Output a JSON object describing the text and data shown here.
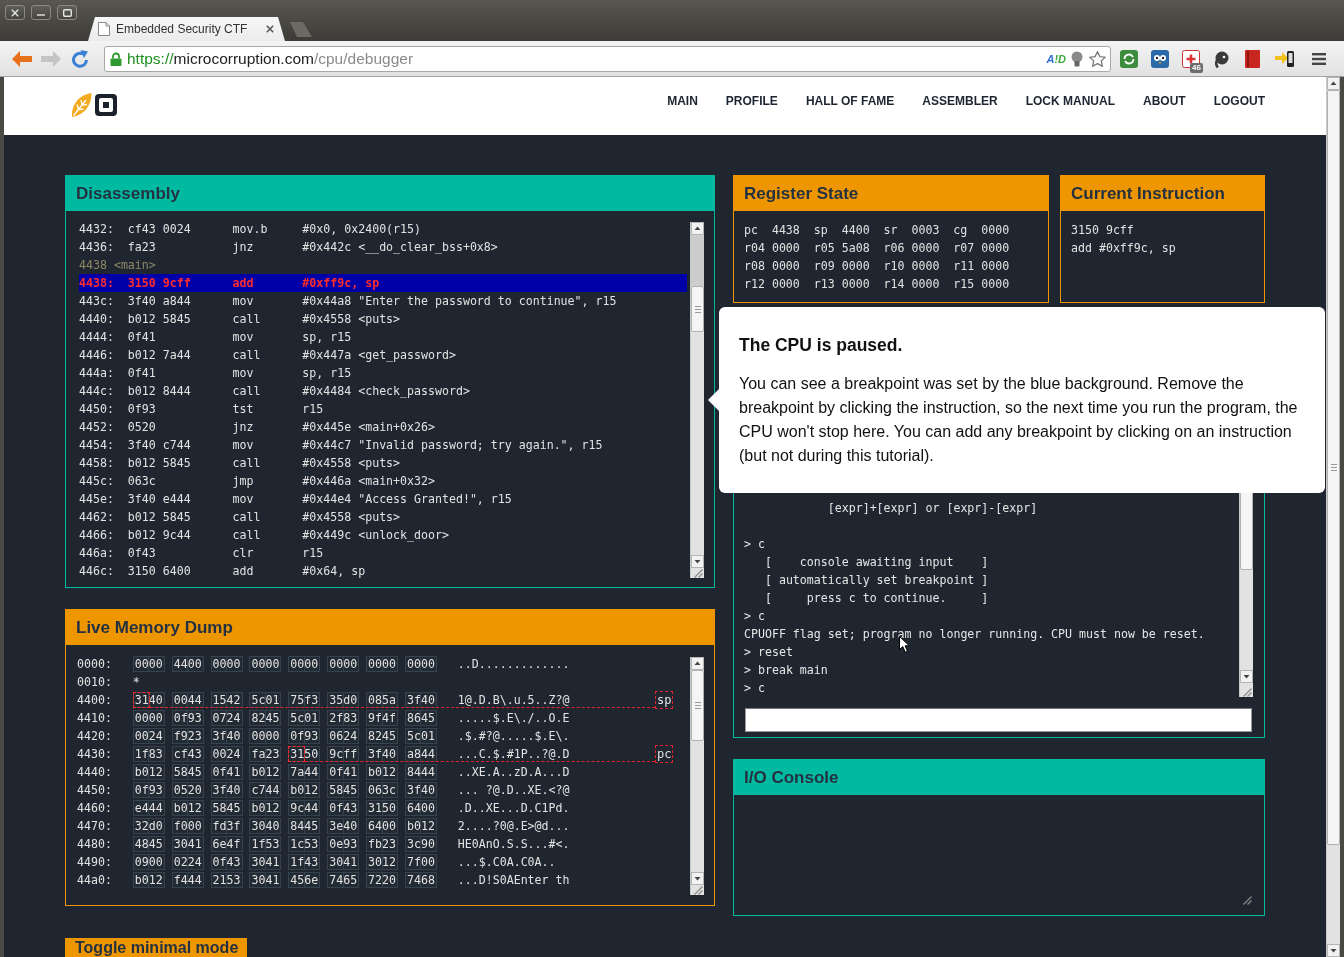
{
  "tab": {
    "title": "Embedded Security CTF"
  },
  "address_bar": {
    "scheme": "https://",
    "host": "microcorruption.com",
    "path": "/cpu/debugger",
    "extension_label": "A!D"
  },
  "toolbar": {
    "badge": "46"
  },
  "nav": [
    "MAIN",
    "PROFILE",
    "HALL OF FAME",
    "ASSEMBLER",
    "LOCK MANUAL",
    "ABOUT",
    "LOGOUT"
  ],
  "disassembly": {
    "title": "Disassembly",
    "rows": [
      {
        "kind": "instruction",
        "address": "4432:",
        "bytes": "cf43 0024",
        "mnemonic": "mov.b",
        "operands": "#0x0, 0x2400(r15)",
        "breakpoint": false,
        "current": false
      },
      {
        "kind": "instruction",
        "address": "4436:",
        "bytes": "fa23",
        "mnemonic": "jnz",
        "operands": "#0x442c <__do_clear_bss+0x8>",
        "breakpoint": false,
        "current": false
      },
      {
        "kind": "label",
        "text": "4438 <main>",
        "breakpoint": false,
        "current": false
      },
      {
        "kind": "instruction",
        "address": "4438:",
        "bytes": "3150 9cff",
        "mnemonic": "add",
        "operands": "#0xff9c, sp",
        "breakpoint": true,
        "current": true
      },
      {
        "kind": "instruction",
        "address": "443c:",
        "bytes": "3f40 a844",
        "mnemonic": "mov",
        "operands": "#0x44a8 \"Enter the password to continue\", r15",
        "breakpoint": false,
        "current": false
      },
      {
        "kind": "instruction",
        "address": "4440:",
        "bytes": "b012 5845",
        "mnemonic": "call",
        "operands": "#0x4558 <puts>",
        "breakpoint": false,
        "current": false
      },
      {
        "kind": "instruction",
        "address": "4444:",
        "bytes": "0f41",
        "mnemonic": "mov",
        "operands": "sp, r15",
        "breakpoint": false,
        "current": false
      },
      {
        "kind": "instruction",
        "address": "4446:",
        "bytes": "b012 7a44",
        "mnemonic": "call",
        "operands": "#0x447a <get_password>",
        "breakpoint": false,
        "current": false
      },
      {
        "kind": "instruction",
        "address": "444a:",
        "bytes": "0f41",
        "mnemonic": "mov",
        "operands": "sp, r15",
        "breakpoint": false,
        "current": false
      },
      {
        "kind": "instruction",
        "address": "444c:",
        "bytes": "b012 8444",
        "mnemonic": "call",
        "operands": "#0x4484 <check_password>",
        "breakpoint": false,
        "current": false
      },
      {
        "kind": "instruction",
        "address": "4450:",
        "bytes": "0f93",
        "mnemonic": "tst",
        "operands": "r15",
        "breakpoint": false,
        "current": false
      },
      {
        "kind": "instruction",
        "address": "4452:",
        "bytes": "0520",
        "mnemonic": "jnz",
        "operands": "#0x445e <main+0x26>",
        "breakpoint": false,
        "current": false
      },
      {
        "kind": "instruction",
        "address": "4454:",
        "bytes": "3f40 c744",
        "mnemonic": "mov",
        "operands": "#0x44c7 \"Invalid password; try again.\", r15",
        "breakpoint": false,
        "current": false
      },
      {
        "kind": "instruction",
        "address": "4458:",
        "bytes": "b012 5845",
        "mnemonic": "call",
        "operands": "#0x4558 <puts>",
        "breakpoint": false,
        "current": false
      },
      {
        "kind": "instruction",
        "address": "445c:",
        "bytes": "063c",
        "mnemonic": "jmp",
        "operands": "#0x446a <main+0x32>",
        "breakpoint": false,
        "current": false
      },
      {
        "kind": "instruction",
        "address": "445e:",
        "bytes": "3f40 e444",
        "mnemonic": "mov",
        "operands": "#0x44e4 \"Access Granted!\", r15",
        "breakpoint": false,
        "current": false
      },
      {
        "kind": "instruction",
        "address": "4462:",
        "bytes": "b012 5845",
        "mnemonic": "call",
        "operands": "#0x4558 <puts>",
        "breakpoint": false,
        "current": false
      },
      {
        "kind": "instruction",
        "address": "4466:",
        "bytes": "b012 9c44",
        "mnemonic": "call",
        "operands": "#0x449c <unlock_door>",
        "breakpoint": false,
        "current": false
      },
      {
        "kind": "instruction",
        "address": "446a:",
        "bytes": "0f43",
        "mnemonic": "clr",
        "operands": "r15",
        "breakpoint": false,
        "current": false
      },
      {
        "kind": "instruction",
        "address": "446c:",
        "bytes": "3150 6400",
        "mnemonic": "add",
        "operands": "#0x64, sp",
        "breakpoint": false,
        "current": false
      }
    ]
  },
  "memory_dump": {
    "title": "Live Memory Dump",
    "rows": [
      {
        "kind": "data",
        "address": "0000:",
        "words": [
          {
            "hex": "0000",
            "pointer_target": false
          },
          {
            "hex": "4400",
            "pointer_target": false
          },
          {
            "hex": "0000",
            "pointer_target": false
          },
          {
            "hex": "0000",
            "pointer_target": false
          },
          {
            "hex": "0000",
            "pointer_target": false
          },
          {
            "hex": "0000",
            "pointer_target": false
          },
          {
            "hex": "0000",
            "pointer_target": false
          },
          {
            "hex": "0000",
            "pointer_target": false
          }
        ],
        "ascii": "..D............."
      },
      {
        "kind": "repeat",
        "address": "0010:",
        "text": "*"
      },
      {
        "kind": "data",
        "address": "4400:",
        "words": [
          {
            "hex": "3140",
            "pointer_target": true
          },
          {
            "hex": "0044",
            "pointer_target": false
          },
          {
            "hex": "1542",
            "pointer_target": false
          },
          {
            "hex": "5c01",
            "pointer_target": false
          },
          {
            "hex": "75f3",
            "pointer_target": false
          },
          {
            "hex": "35d0",
            "pointer_target": false
          },
          {
            "hex": "085a",
            "pointer_target": false
          },
          {
            "hex": "3f40",
            "pointer_target": false
          }
        ],
        "ascii": "1@.D.B\\.u.5..Z?@",
        "pointer_label": "sp"
      },
      {
        "kind": "data",
        "address": "4410:",
        "words": [
          {
            "hex": "0000",
            "pointer_target": false
          },
          {
            "hex": "0f93",
            "pointer_target": false
          },
          {
            "hex": "0724",
            "pointer_target": false
          },
          {
            "hex": "8245",
            "pointer_target": false
          },
          {
            "hex": "5c01",
            "pointer_target": false
          },
          {
            "hex": "2f83",
            "pointer_target": false
          },
          {
            "hex": "9f4f",
            "pointer_target": false
          },
          {
            "hex": "8645",
            "pointer_target": false
          }
        ],
        "ascii": ".....$.E\\./..O.E"
      },
      {
        "kind": "data",
        "address": "4420:",
        "words": [
          {
            "hex": "0024",
            "pointer_target": false
          },
          {
            "hex": "f923",
            "pointer_target": false
          },
          {
            "hex": "3f40",
            "pointer_target": false
          },
          {
            "hex": "0000",
            "pointer_target": false
          },
          {
            "hex": "0f93",
            "pointer_target": false
          },
          {
            "hex": "0624",
            "pointer_target": false
          },
          {
            "hex": "8245",
            "pointer_target": false
          },
          {
            "hex": "5c01",
            "pointer_target": false
          }
        ],
        "ascii": ".$.#?@.....$.E\\."
      },
      {
        "kind": "data",
        "address": "4430:",
        "words": [
          {
            "hex": "1f83",
            "pointer_target": false
          },
          {
            "hex": "cf43",
            "pointer_target": false
          },
          {
            "hex": "0024",
            "pointer_target": false
          },
          {
            "hex": "fa23",
            "pointer_target": false
          },
          {
            "hex": "3150",
            "pointer_target": true
          },
          {
            "hex": "9cff",
            "pointer_target": false
          },
          {
            "hex": "3f40",
            "pointer_target": false
          },
          {
            "hex": "a844",
            "pointer_target": false
          }
        ],
        "ascii": "...C.$.#1P..?@.D",
        "pointer_label": "pc"
      },
      {
        "kind": "data",
        "address": "4440:",
        "words": [
          {
            "hex": "b012",
            "pointer_target": false
          },
          {
            "hex": "5845",
            "pointer_target": false
          },
          {
            "hex": "0f41",
            "pointer_target": false
          },
          {
            "hex": "b012",
            "pointer_target": false
          },
          {
            "hex": "7a44",
            "pointer_target": false
          },
          {
            "hex": "0f41",
            "pointer_target": false
          },
          {
            "hex": "b012",
            "pointer_target": false
          },
          {
            "hex": "8444",
            "pointer_target": false
          }
        ],
        "ascii": "..XE.A..zD.A...D"
      },
      {
        "kind": "data",
        "address": "4450:",
        "words": [
          {
            "hex": "0f93",
            "pointer_target": false
          },
          {
            "hex": "0520",
            "pointer_target": false
          },
          {
            "hex": "3f40",
            "pointer_target": false
          },
          {
            "hex": "c744",
            "pointer_target": false
          },
          {
            "hex": "b012",
            "pointer_target": false
          },
          {
            "hex": "5845",
            "pointer_target": false
          },
          {
            "hex": "063c",
            "pointer_target": false
          },
          {
            "hex": "3f40",
            "pointer_target": false
          }
        ],
        "ascii": "... ?@.D..XE.<?@"
      },
      {
        "kind": "data",
        "address": "4460:",
        "words": [
          {
            "hex": "e444",
            "pointer_target": false
          },
          {
            "hex": "b012",
            "pointer_target": false
          },
          {
            "hex": "5845",
            "pointer_target": false
          },
          {
            "hex": "b012",
            "pointer_target": false
          },
          {
            "hex": "9c44",
            "pointer_target": false
          },
          {
            "hex": "0f43",
            "pointer_target": false
          },
          {
            "hex": "3150",
            "pointer_target": false
          },
          {
            "hex": "6400",
            "pointer_target": false
          }
        ],
        "ascii": ".D..XE...D.C1Pd."
      },
      {
        "kind": "data",
        "address": "4470:",
        "words": [
          {
            "hex": "32d0",
            "pointer_target": false
          },
          {
            "hex": "f000",
            "pointer_target": false
          },
          {
            "hex": "fd3f",
            "pointer_target": false
          },
          {
            "hex": "3040",
            "pointer_target": false
          },
          {
            "hex": "8445",
            "pointer_target": false
          },
          {
            "hex": "3e40",
            "pointer_target": false
          },
          {
            "hex": "6400",
            "pointer_target": false
          },
          {
            "hex": "b012",
            "pointer_target": false
          }
        ],
        "ascii": "2....?0@.E>@d..."
      },
      {
        "kind": "data",
        "address": "4480:",
        "words": [
          {
            "hex": "4845",
            "pointer_target": false
          },
          {
            "hex": "3041",
            "pointer_target": false
          },
          {
            "hex": "6e4f",
            "pointer_target": false
          },
          {
            "hex": "1f53",
            "pointer_target": false
          },
          {
            "hex": "1c53",
            "pointer_target": false
          },
          {
            "hex": "0e93",
            "pointer_target": false
          },
          {
            "hex": "fb23",
            "pointer_target": false
          },
          {
            "hex": "3c90",
            "pointer_target": false
          }
        ],
        "ascii": "HE0AnO.S.S...#<."
      },
      {
        "kind": "data",
        "address": "4490:",
        "words": [
          {
            "hex": "0900",
            "pointer_target": false
          },
          {
            "hex": "0224",
            "pointer_target": false
          },
          {
            "hex": "0f43",
            "pointer_target": false
          },
          {
            "hex": "3041",
            "pointer_target": false
          },
          {
            "hex": "1f43",
            "pointer_target": false
          },
          {
            "hex": "3041",
            "pointer_target": false
          },
          {
            "hex": "3012",
            "pointer_target": false
          },
          {
            "hex": "7f00",
            "pointer_target": false
          }
        ],
        "ascii": "...$.C0A.C0A.."
      },
      {
        "kind": "data",
        "address": "44a0:",
        "words": [
          {
            "hex": "b012",
            "pointer_target": false
          },
          {
            "hex": "f444",
            "pointer_target": false
          },
          {
            "hex": "2153",
            "pointer_target": false
          },
          {
            "hex": "3041",
            "pointer_target": false
          },
          {
            "hex": "456e",
            "pointer_target": false
          },
          {
            "hex": "7465",
            "pointer_target": false
          },
          {
            "hex": "7220",
            "pointer_target": false
          },
          {
            "hex": "7468",
            "pointer_target": false
          }
        ],
        "ascii": "...D!S0AEnter th"
      }
    ]
  },
  "register_state": {
    "title": "Register State",
    "registers": [
      {
        "name": "pc",
        "value": "4438"
      },
      {
        "name": "sp",
        "value": "4400"
      },
      {
        "name": "sr",
        "value": "0003"
      },
      {
        "name": "cg",
        "value": "0000"
      },
      {
        "name": "r04",
        "value": "0000"
      },
      {
        "name": "r05",
        "value": "5a08"
      },
      {
        "name": "r06",
        "value": "0000"
      },
      {
        "name": "r07",
        "value": "0000"
      },
      {
        "name": "r08",
        "value": "0000"
      },
      {
        "name": "r09",
        "value": "0000"
      },
      {
        "name": "r10",
        "value": "0000"
      },
      {
        "name": "r11",
        "value": "0000"
      },
      {
        "name": "r12",
        "value": "0000"
      },
      {
        "name": "r13",
        "value": "0000"
      },
      {
        "name": "r14",
        "value": "0000"
      },
      {
        "name": "r15",
        "value": "0000"
      }
    ]
  },
  "current_instruction": {
    "title": "Current Instruction",
    "bytes": "3150 9cff",
    "assembly": "add #0xff9c, sp"
  },
  "tutorial": {
    "title": "The CPU is paused.",
    "text": "You can see a breakpoint was set by the blue background. Remove the breakpoint by clicking the instruction, so the next time you run the program, the CPU won't stop here. You can add any breakpoint by clicking on an instruction (but not during this tutorial)."
  },
  "debugger_console": {
    "blocks": [
      [
        "            [expr]+[expr] or [expr]-[expr]"
      ],
      [
        "> c",
        "   [    console awaiting input    ]",
        "   [ automatically set breakpoint ]",
        "   [     press c to continue.     ]",
        "> c",
        "CPUOFF flag set; program no longer running. CPU must now be reset.",
        "> reset",
        "> break main",
        "> c"
      ]
    ]
  },
  "io_console": {
    "title": "I/O Console"
  },
  "toggle_button": {
    "label": "Toggle minimal mode"
  }
}
